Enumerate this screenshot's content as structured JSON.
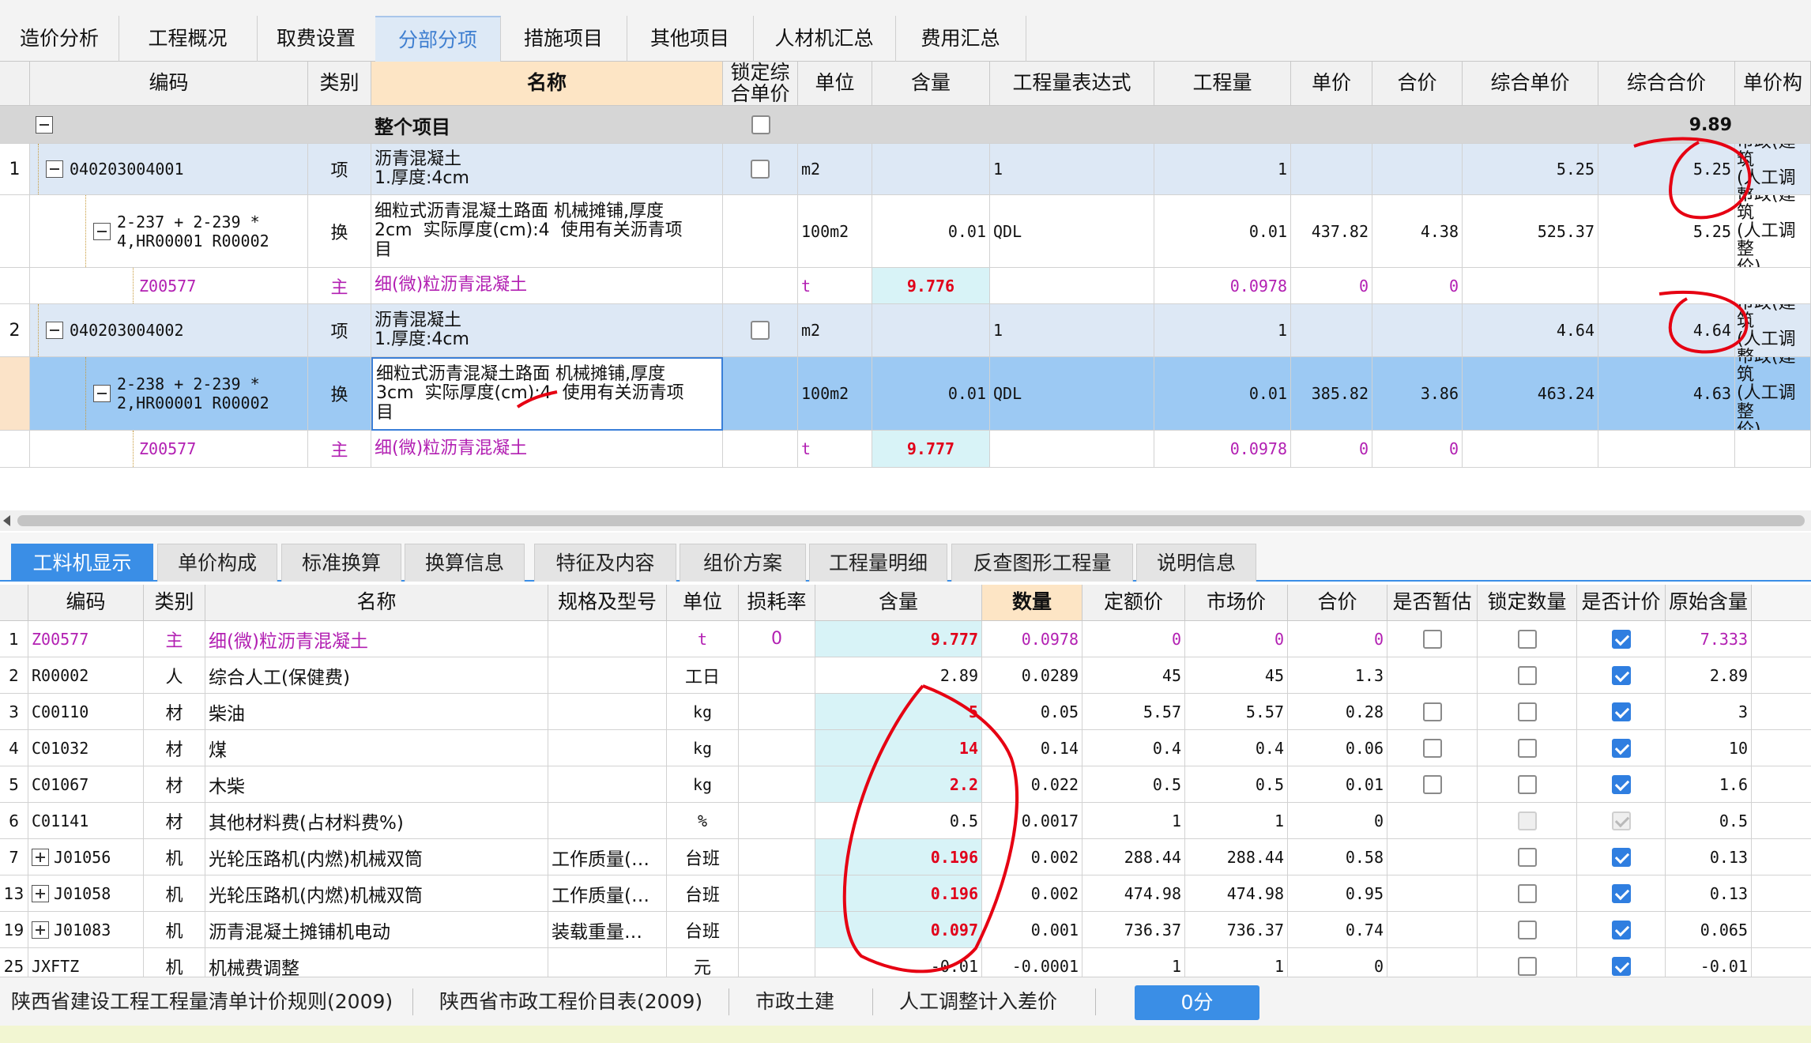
{
  "top_tabs": [
    "造价分析",
    "工程概况",
    "取费设置",
    "分部分项",
    "措施项目",
    "其他项目",
    "人材机汇总",
    "费用汇总"
  ],
  "top_active_index": 3,
  "upper_headers": [
    "编码",
    "类别",
    "名称",
    "锁定综\n合单价",
    "单位",
    "含量",
    "工程量表达式",
    "工程量",
    "单价",
    "合价",
    "综合单价",
    "综合合价",
    "单价构"
  ],
  "upper_total_label": "整个项目",
  "upper_total_value": "9.89",
  "upper_rows": [
    {
      "no": "1",
      "code": "040203004001",
      "type": "项",
      "name": "沥青混凝土\n1.厚度:4cm",
      "unit": "m2",
      "qty": "",
      "expr": "1",
      "amount": "1",
      "price": "",
      "sum": "",
      "comp_price": "5.25",
      "comp_sum": "5.25",
      "build": "市政(建筑\n(人工调整"
    },
    {
      "no": "",
      "code": "2-237 + 2-239 *\n4,HR00001 R00002",
      "type": "换",
      "name": "细粒式沥青混凝土路面 机械摊铺,厚度\n2cm  实际厚度(cm):4  使用有关沥青项\n目",
      "unit": "100m2",
      "qty": "0.01",
      "expr": "QDL",
      "amount": "0.01",
      "price": "437.82",
      "sum": "4.38",
      "comp_price": "525.37",
      "comp_sum": "5.25",
      "build": "市政(建筑\n(人工调整\n价)"
    },
    {
      "no": "",
      "code": "Z00577",
      "type": "主",
      "name": "细(微)粒沥青混凝土",
      "unit": "t",
      "qty": "9.776",
      "expr": "",
      "amount": "0.0978",
      "price": "0",
      "sum": "0",
      "comp_price": "",
      "comp_sum": "",
      "build": ""
    },
    {
      "no": "2",
      "code": "040203004002",
      "type": "项",
      "name": "沥青混凝土\n1.厚度:4cm",
      "unit": "m2",
      "qty": "",
      "expr": "1",
      "amount": "1",
      "price": "",
      "sum": "",
      "comp_price": "4.64",
      "comp_sum": "4.64",
      "build": "市政(建筑\n(人工调整"
    },
    {
      "no": "",
      "code": "2-238 + 2-239 *\n2,HR00001 R00002",
      "type": "换",
      "name": "细粒式沥青混凝土路面 机械摊铺,厚度\n3cm  实际厚度(cm):4  使用有关沥青项\n目",
      "unit": "100m2",
      "qty": "0.01",
      "expr": "QDL",
      "amount": "0.01",
      "price": "385.82",
      "sum": "3.86",
      "comp_price": "463.24",
      "comp_sum": "4.63",
      "build": "市政(建筑\n(人工调整\n价)"
    },
    {
      "no": "",
      "code": "Z00577",
      "type": "主",
      "name": "细(微)粒沥青混凝土",
      "unit": "t",
      "qty": "9.777",
      "expr": "",
      "amount": "0.0978",
      "price": "0",
      "sum": "0",
      "comp_price": "",
      "comp_sum": "",
      "build": ""
    }
  ],
  "bottom_tabs": [
    "工料机显示",
    "单价构成",
    "标准换算",
    "换算信息",
    "特征及内容",
    "组价方案",
    "工程量明细",
    "反查图形工程量",
    "说明信息"
  ],
  "bottom_active_index": 0,
  "lower_headers": [
    "编码",
    "类别",
    "名称",
    "规格及型号",
    "单位",
    "损耗率",
    "含量",
    "数量",
    "定额价",
    "市场价",
    "合价",
    "是否暂估",
    "锁定数量",
    "是否计价",
    "原始含量"
  ],
  "lower_rows": [
    {
      "no": "1",
      "code": "Z00577",
      "type": "主",
      "name": "细(微)粒沥青混凝土",
      "spec": "",
      "unit": "t",
      "loss": "0",
      "qty": "9.777",
      "num": "0.0978",
      "quota": "0",
      "market": "0",
      "sum": "0",
      "est": "off",
      "lock": "off",
      "priced": "on",
      "orig": "7.333",
      "purple": true,
      "red": true,
      "plus": false
    },
    {
      "no": "2",
      "code": "R00002",
      "type": "人",
      "name": "综合人工(保健费)",
      "spec": "",
      "unit": "工日",
      "loss": "",
      "qty": "2.89",
      "num": "0.0289",
      "quota": "45",
      "market": "45",
      "sum": "1.3",
      "est": "none",
      "lock": "off",
      "priced": "on",
      "orig": "2.89",
      "purple": false,
      "red": false,
      "plus": false
    },
    {
      "no": "3",
      "code": "C00110",
      "type": "材",
      "name": "柴油",
      "spec": "",
      "unit": "kg",
      "loss": "",
      "qty": "5",
      "num": "0.05",
      "quota": "5.57",
      "market": "5.57",
      "sum": "0.28",
      "est": "off",
      "lock": "off",
      "priced": "on",
      "orig": "3",
      "purple": false,
      "red": true,
      "plus": false
    },
    {
      "no": "4",
      "code": "C01032",
      "type": "材",
      "name": "煤",
      "spec": "",
      "unit": "kg",
      "loss": "",
      "qty": "14",
      "num": "0.14",
      "quota": "0.4",
      "market": "0.4",
      "sum": "0.06",
      "est": "off",
      "lock": "off",
      "priced": "on",
      "orig": "10",
      "purple": false,
      "red": true,
      "plus": false
    },
    {
      "no": "5",
      "code": "C01067",
      "type": "材",
      "name": "木柴",
      "spec": "",
      "unit": "kg",
      "loss": "",
      "qty": "2.2",
      "num": "0.022",
      "quota": "0.5",
      "market": "0.5",
      "sum": "0.01",
      "est": "off",
      "lock": "off",
      "priced": "on",
      "orig": "1.6",
      "purple": false,
      "red": true,
      "plus": false
    },
    {
      "no": "6",
      "code": "C01141",
      "type": "材",
      "name": "其他材料费(占材料费%)",
      "spec": "",
      "unit": "%",
      "loss": "",
      "qty": "0.5",
      "num": "0.0017",
      "quota": "1",
      "market": "1",
      "sum": "0",
      "est": "none",
      "lock": "dis",
      "priced": "dison",
      "orig": "0.5",
      "purple": false,
      "red": false,
      "plus": false
    },
    {
      "no": "7",
      "code": "J01056",
      "type": "机",
      "name": "光轮压路机(内燃)机械双筒",
      "spec": "工作质量(…",
      "unit": "台班",
      "loss": "",
      "qty": "0.196",
      "num": "0.002",
      "quota": "288.44",
      "market": "288.44",
      "sum": "0.58",
      "est": "none",
      "lock": "off",
      "priced": "on",
      "orig": "0.13",
      "purple": false,
      "red": true,
      "plus": true
    },
    {
      "no": "13",
      "code": "J01058",
      "type": "机",
      "name": "光轮压路机(内燃)机械双筒",
      "spec": "工作质量(…",
      "unit": "台班",
      "loss": "",
      "qty": "0.196",
      "num": "0.002",
      "quota": "474.98",
      "market": "474.98",
      "sum": "0.95",
      "est": "none",
      "lock": "off",
      "priced": "on",
      "orig": "0.13",
      "purple": false,
      "red": true,
      "plus": true
    },
    {
      "no": "19",
      "code": "J01083",
      "type": "机",
      "name": "沥青混凝土摊铺机电动",
      "spec": "装载重量…",
      "unit": "台班",
      "loss": "",
      "qty": "0.097",
      "num": "0.001",
      "quota": "736.37",
      "market": "736.37",
      "sum": "0.74",
      "est": "none",
      "lock": "off",
      "priced": "on",
      "orig": "0.065",
      "purple": false,
      "red": true,
      "plus": true
    },
    {
      "no": "25",
      "code": "JXFTZ",
      "type": "机",
      "name": "机械费调整",
      "spec": "",
      "unit": "元",
      "loss": "",
      "qty": "-0.01",
      "num": "-0.0001",
      "quota": "1",
      "market": "1",
      "sum": "0",
      "est": "none",
      "lock": "off",
      "priced": "on",
      "orig": "-0.01",
      "purple": false,
      "red": false,
      "plus": false
    }
  ],
  "status": {
    "rule": "陕西省建设工程工程量清单计价规则(2009)",
    "price_table": "陕西省市政工程价目表(2009)",
    "specialty": "市政土建",
    "labor": "人工调整计入差价",
    "score": "0分"
  },
  "colors": {
    "accent": "#3a8ee6",
    "item_row": "#dde8f5",
    "selected_row": "#9cc9f3",
    "content_cell": "#d8f3f7",
    "purple": "#b21fb2",
    "red": "#e1001a",
    "annotation": "#e60012"
  }
}
